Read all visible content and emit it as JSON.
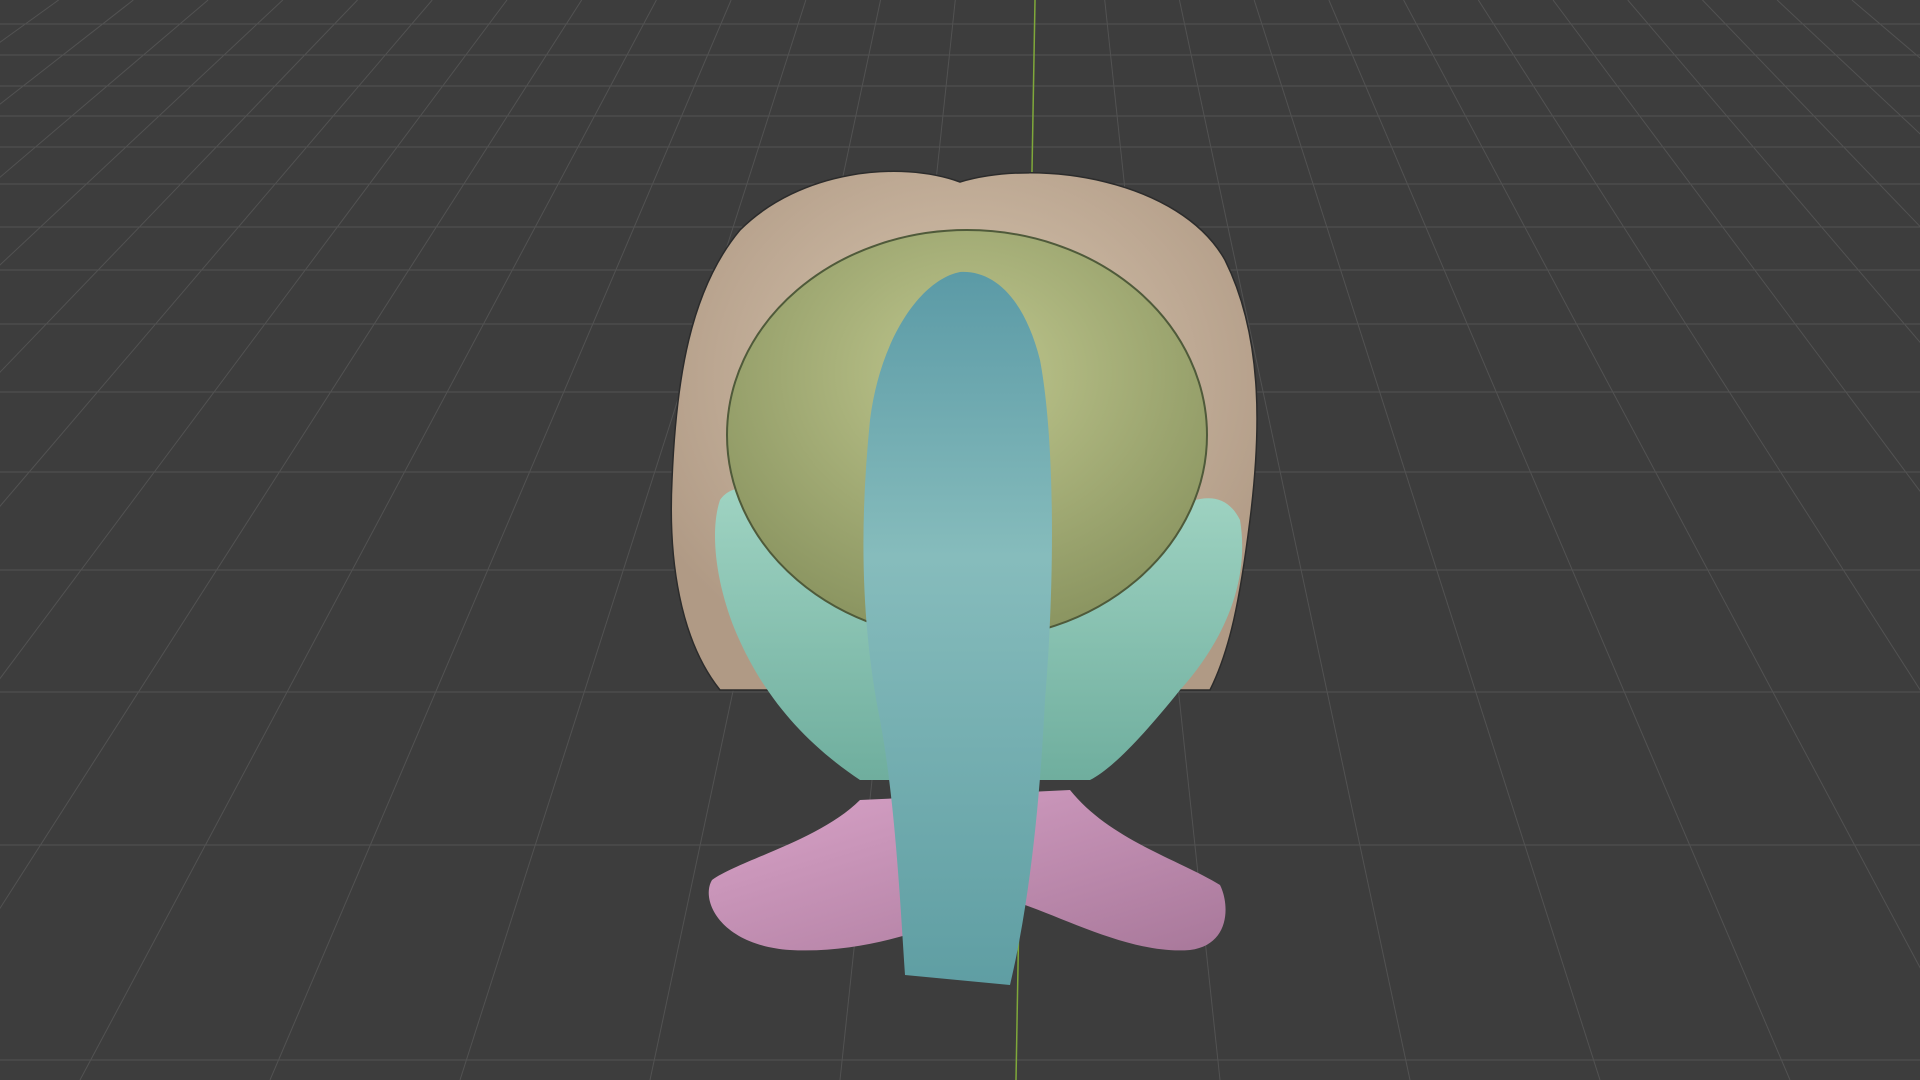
{
  "viewport": {
    "background": "#3d3d3d",
    "grid_color": "#525252",
    "axis_y_color": "#7fa83a"
  },
  "model": {
    "neck_color": "#c88fb4",
    "outer_hair_color": "#c9b39c",
    "top_hair_color": "#a9b27a",
    "side_hair_color": "#8ec6b4",
    "ponytail_color": "#7fb4b6"
  }
}
